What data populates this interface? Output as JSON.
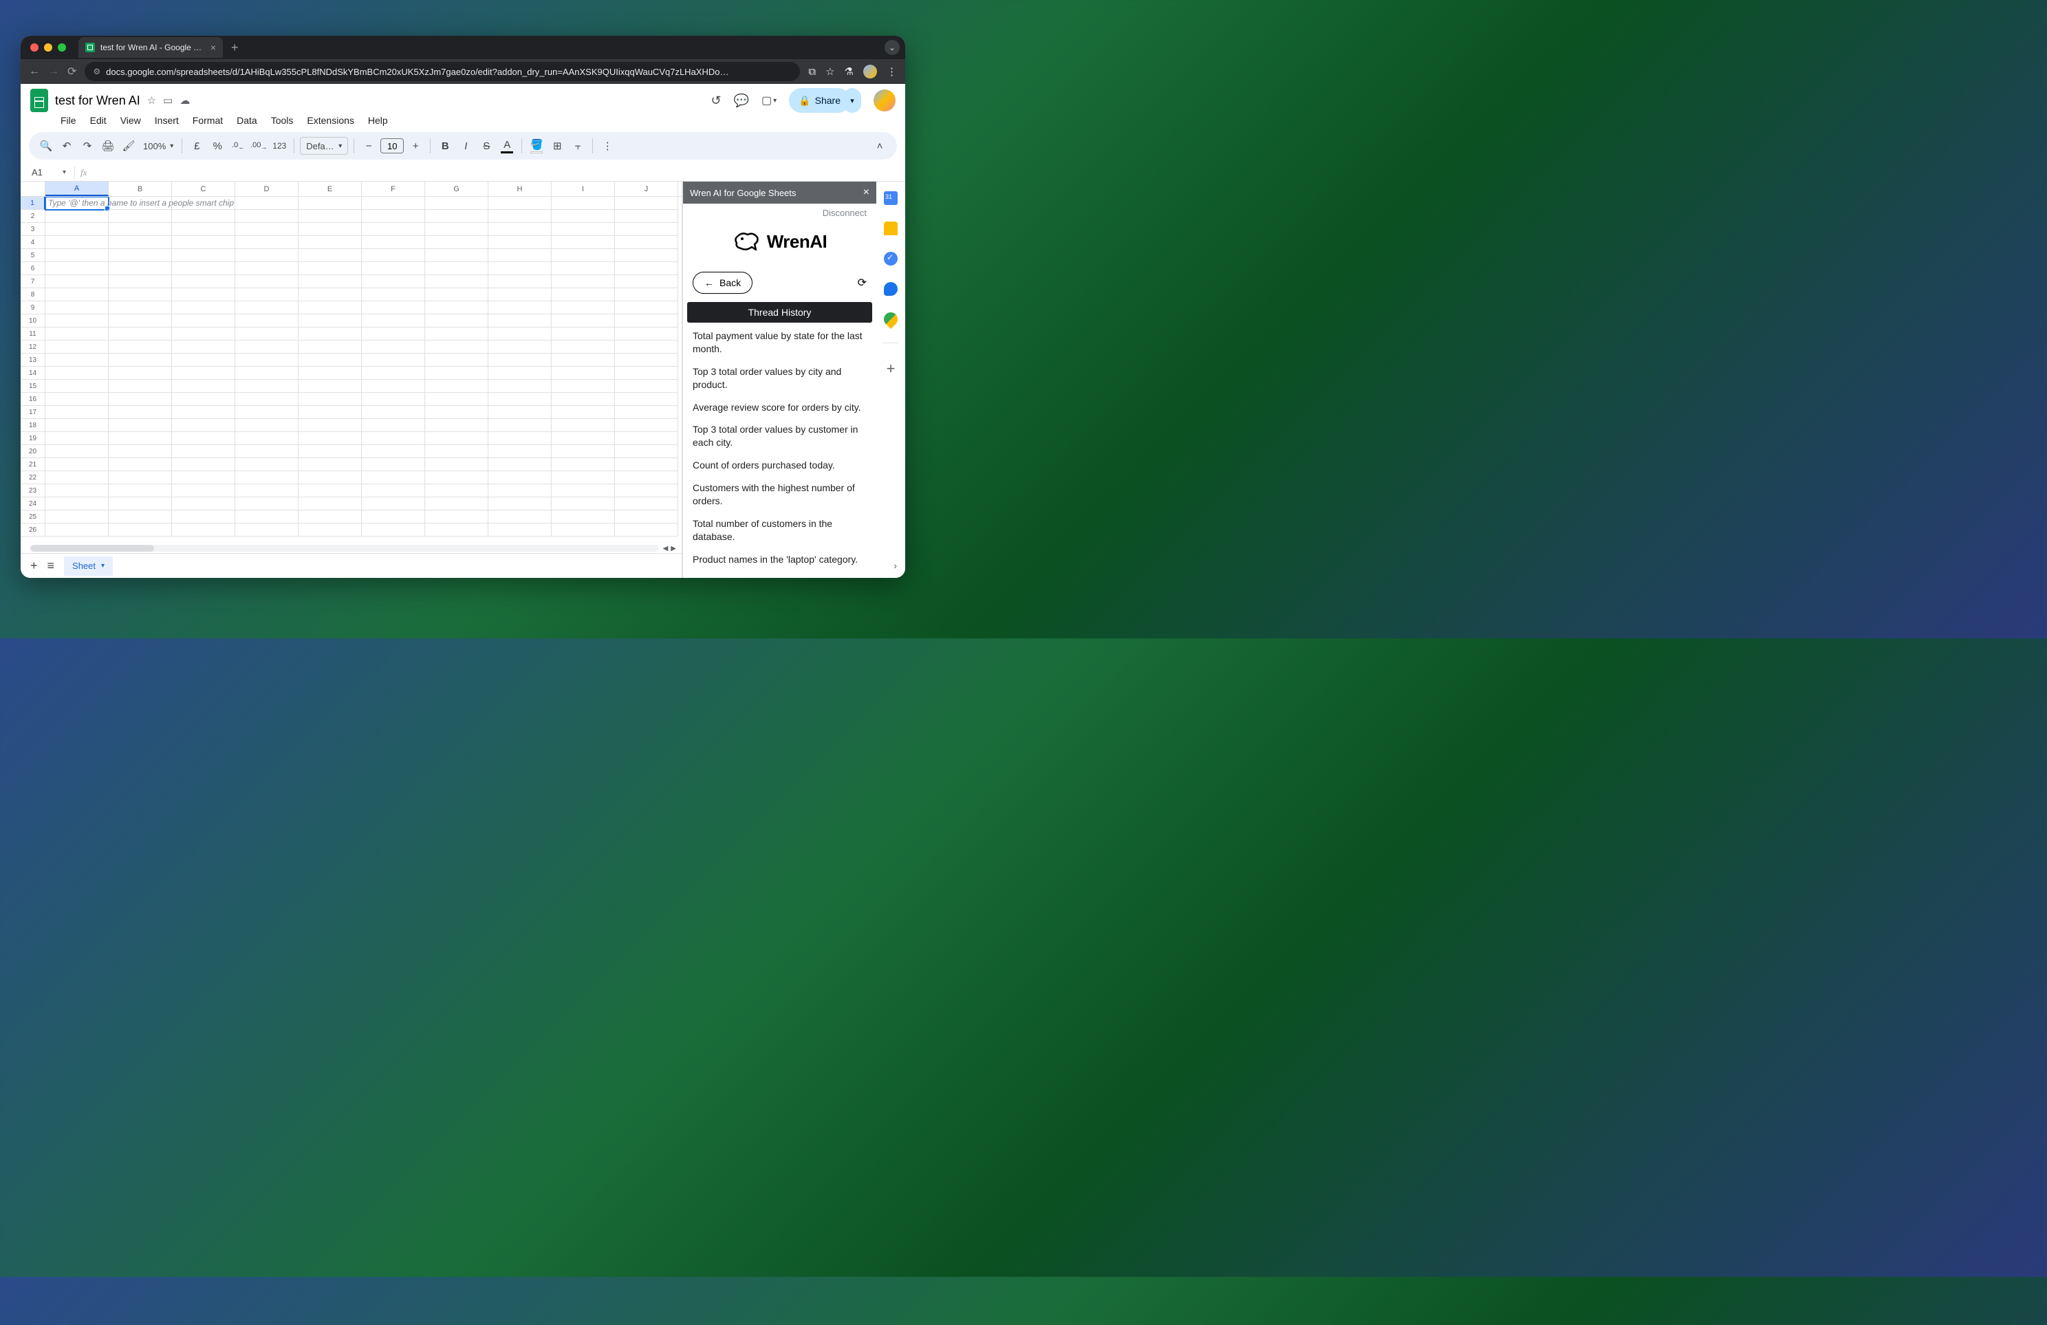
{
  "browser": {
    "tab_title": "test for Wren AI - Google She",
    "url": "docs.google.com/spreadsheets/d/1AHiBqLw355cPL8fNDdSkYBmBCm20xUK5XzJm7gae0zo/edit?addon_dry_run=AAnXSK9QUIixqqWauCVq7zLHaXHDo…"
  },
  "doc": {
    "title": "test for Wren AI",
    "share_label": "Share"
  },
  "menus": [
    "File",
    "Edit",
    "View",
    "Insert",
    "Format",
    "Data",
    "Tools",
    "Extensions",
    "Help"
  ],
  "toolbar": {
    "zoom": "100%",
    "currency": "£",
    "percent": "%",
    "dec_dec": ".0",
    "inc_dec": ".00",
    "num_fmt": "123",
    "font_name": "Defaul…",
    "font_size": "10"
  },
  "namebox": {
    "cell": "A1",
    "fx": "fx"
  },
  "grid": {
    "columns": [
      "A",
      "B",
      "C",
      "D",
      "E",
      "F",
      "G",
      "H",
      "I",
      "J"
    ],
    "row_count": 26,
    "active_cell": "A1",
    "hint": "Type '@' then a name to insert a people smart chip"
  },
  "footer": {
    "sheet_name": "Sheet"
  },
  "sidepanel": {
    "title": "Wren AI for Google Sheets",
    "disconnect": "Disconnect",
    "brand": "WrenAI",
    "back": "Back",
    "thread_header": "Thread History",
    "threads": [
      "Total payment value by state for the last month.",
      "Top 3 total order values by city and product.",
      "Average review score for orders by city.",
      "Top 3 total order values by customer in each city.",
      "Count of orders purchased today.",
      "Customers with the highest number of orders.",
      "Total number of customers in the database.",
      "Product names in the 'laptop' category."
    ]
  }
}
